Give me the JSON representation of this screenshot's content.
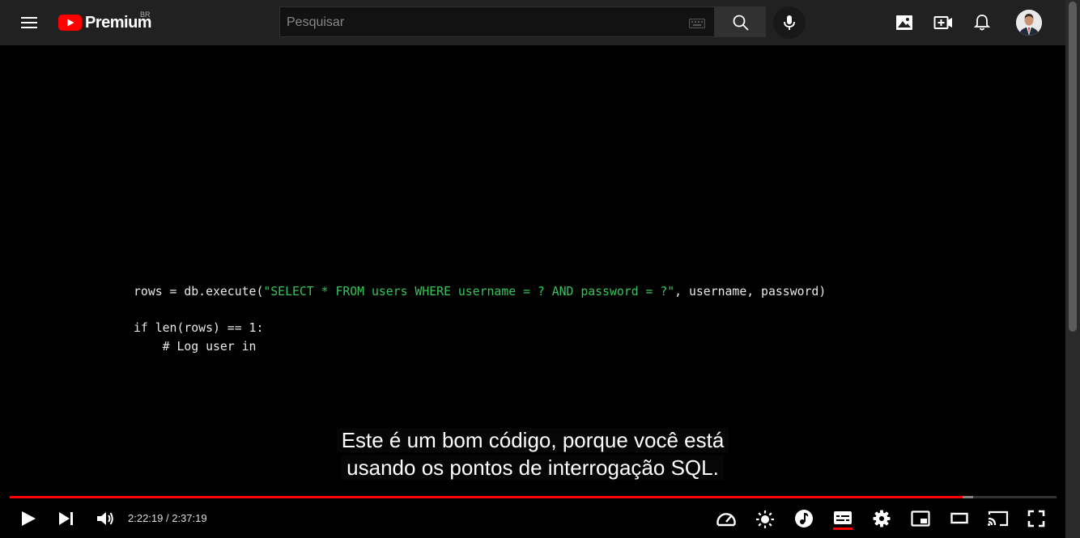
{
  "header": {
    "logo_text": "Premium",
    "country_code": "BR",
    "search_placeholder": "Pesquisar"
  },
  "video": {
    "code_line_1_pre": "rows = db.execute(",
    "code_line_1_string": "\"SELECT * FROM users WHERE username = ? AND password = ?\"",
    "code_line_1_post": ", username, password)",
    "code_line_2": "if len(rows) == 1:",
    "code_line_3": "    # Log user in",
    "caption_line_1": "Este é um bom código, porque você está",
    "caption_line_2": "usando os pontos de interrogação SQL."
  },
  "player": {
    "progress_played": 0.91,
    "progress_loaded": 0.92,
    "time_display": "2:22:19 / 2:37:19"
  },
  "colors": {
    "accent": "#ff0000",
    "code_string": "#36c45a"
  },
  "icons": [
    "menu-icon",
    "youtube-logo-icon",
    "keyboard-icon",
    "search-icon",
    "microphone-icon",
    "image-icon",
    "create-video-icon",
    "notifications-bell-icon",
    "avatar",
    "play-icon",
    "next-icon",
    "volume-icon",
    "playback-speed-icon",
    "brightness-icon",
    "music-icon",
    "subtitles-icon",
    "settings-gear-icon",
    "miniplayer-icon",
    "theater-mode-icon",
    "cast-icon",
    "fullscreen-icon"
  ]
}
